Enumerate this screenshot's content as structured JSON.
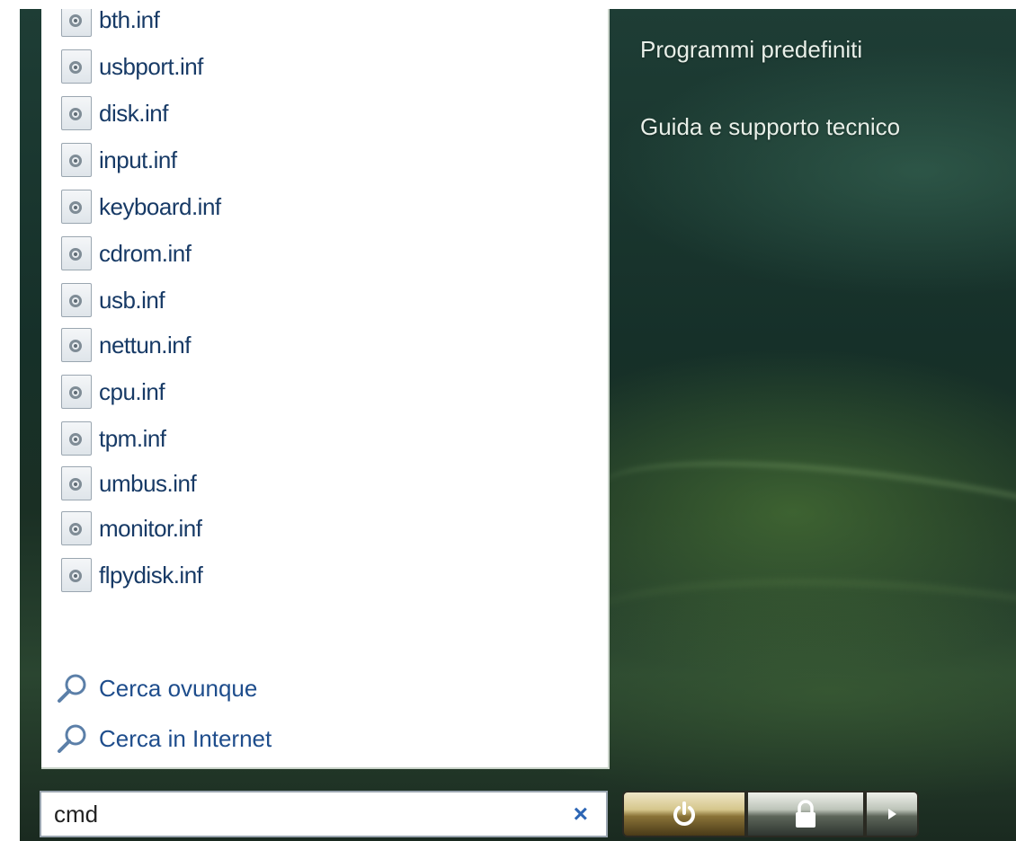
{
  "files": [
    {
      "name": "bth.inf",
      "icon": "inf-file-icon"
    },
    {
      "name": "usbport.inf",
      "icon": "inf-file-icon"
    },
    {
      "name": "disk.inf",
      "icon": "inf-file-icon"
    },
    {
      "name": "input.inf",
      "icon": "inf-file-icon"
    },
    {
      "name": "keyboard.inf",
      "icon": "inf-file-icon"
    },
    {
      "name": "cdrom.inf",
      "icon": "inf-file-icon"
    },
    {
      "name": "usb.inf",
      "icon": "inf-file-icon"
    },
    {
      "name": "nettun.inf",
      "icon": "inf-file-icon"
    },
    {
      "name": "cpu.inf",
      "icon": "inf-file-icon"
    },
    {
      "name": "tpm.inf",
      "icon": "inf-file-icon"
    },
    {
      "name": "umbus.inf",
      "icon": "inf-file-icon"
    },
    {
      "name": "monitor.inf",
      "icon": "inf-file-icon"
    },
    {
      "name": "flpydisk.inf",
      "icon": "inf-file-icon"
    }
  ],
  "search_links": {
    "everywhere": "Cerca ovunque",
    "internet": "Cerca in Internet"
  },
  "right_panel": {
    "default_programs": "Programmi predefiniti",
    "help_support": "Guida e supporto tecnico"
  },
  "search": {
    "value": "cmd",
    "clear_symbol": "×"
  },
  "buttons": {
    "power_icon": "power-icon",
    "lock_icon": "lock-icon",
    "arrow_icon": "arrow-right-icon"
  },
  "colors": {
    "file_text": "#173a66",
    "link_text": "#1e4d8c",
    "right_panel_text": "#e8efe8",
    "clear_icon": "#2d66b5"
  }
}
